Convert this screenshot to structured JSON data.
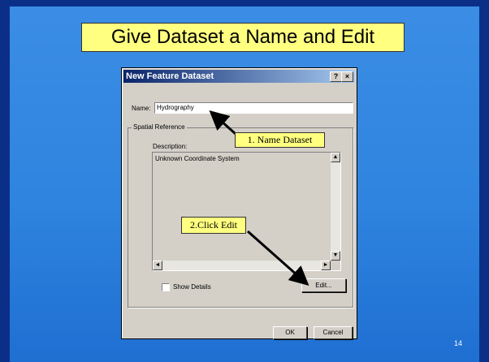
{
  "slide": {
    "title": "Give Dataset a Name and Edit",
    "page_number": "14"
  },
  "dialog": {
    "title": "New Feature Dataset",
    "help_label": "?",
    "close_label": "×",
    "name_label": "Name:",
    "name_value": "Hydrography",
    "spatial_reference_label": "Spatial Reference",
    "description_label": "Description:",
    "description_value": "Unknown Coordinate System",
    "show_details_label": "Show Details",
    "edit_button_label": "Edit...",
    "ok_button_label": "OK",
    "cancel_button_label": "Cancel"
  },
  "annotations": {
    "step1": "1. Name Dataset",
    "step2": "2.Click Edit"
  },
  "colors": {
    "slide_background": "#2f84df",
    "callout_fill": "#ffff80",
    "titlebar_start": "#0a246a"
  },
  "icons": {
    "scroll_up": "▲",
    "scroll_down": "▼",
    "scroll_left": "◄",
    "scroll_right": "►"
  }
}
